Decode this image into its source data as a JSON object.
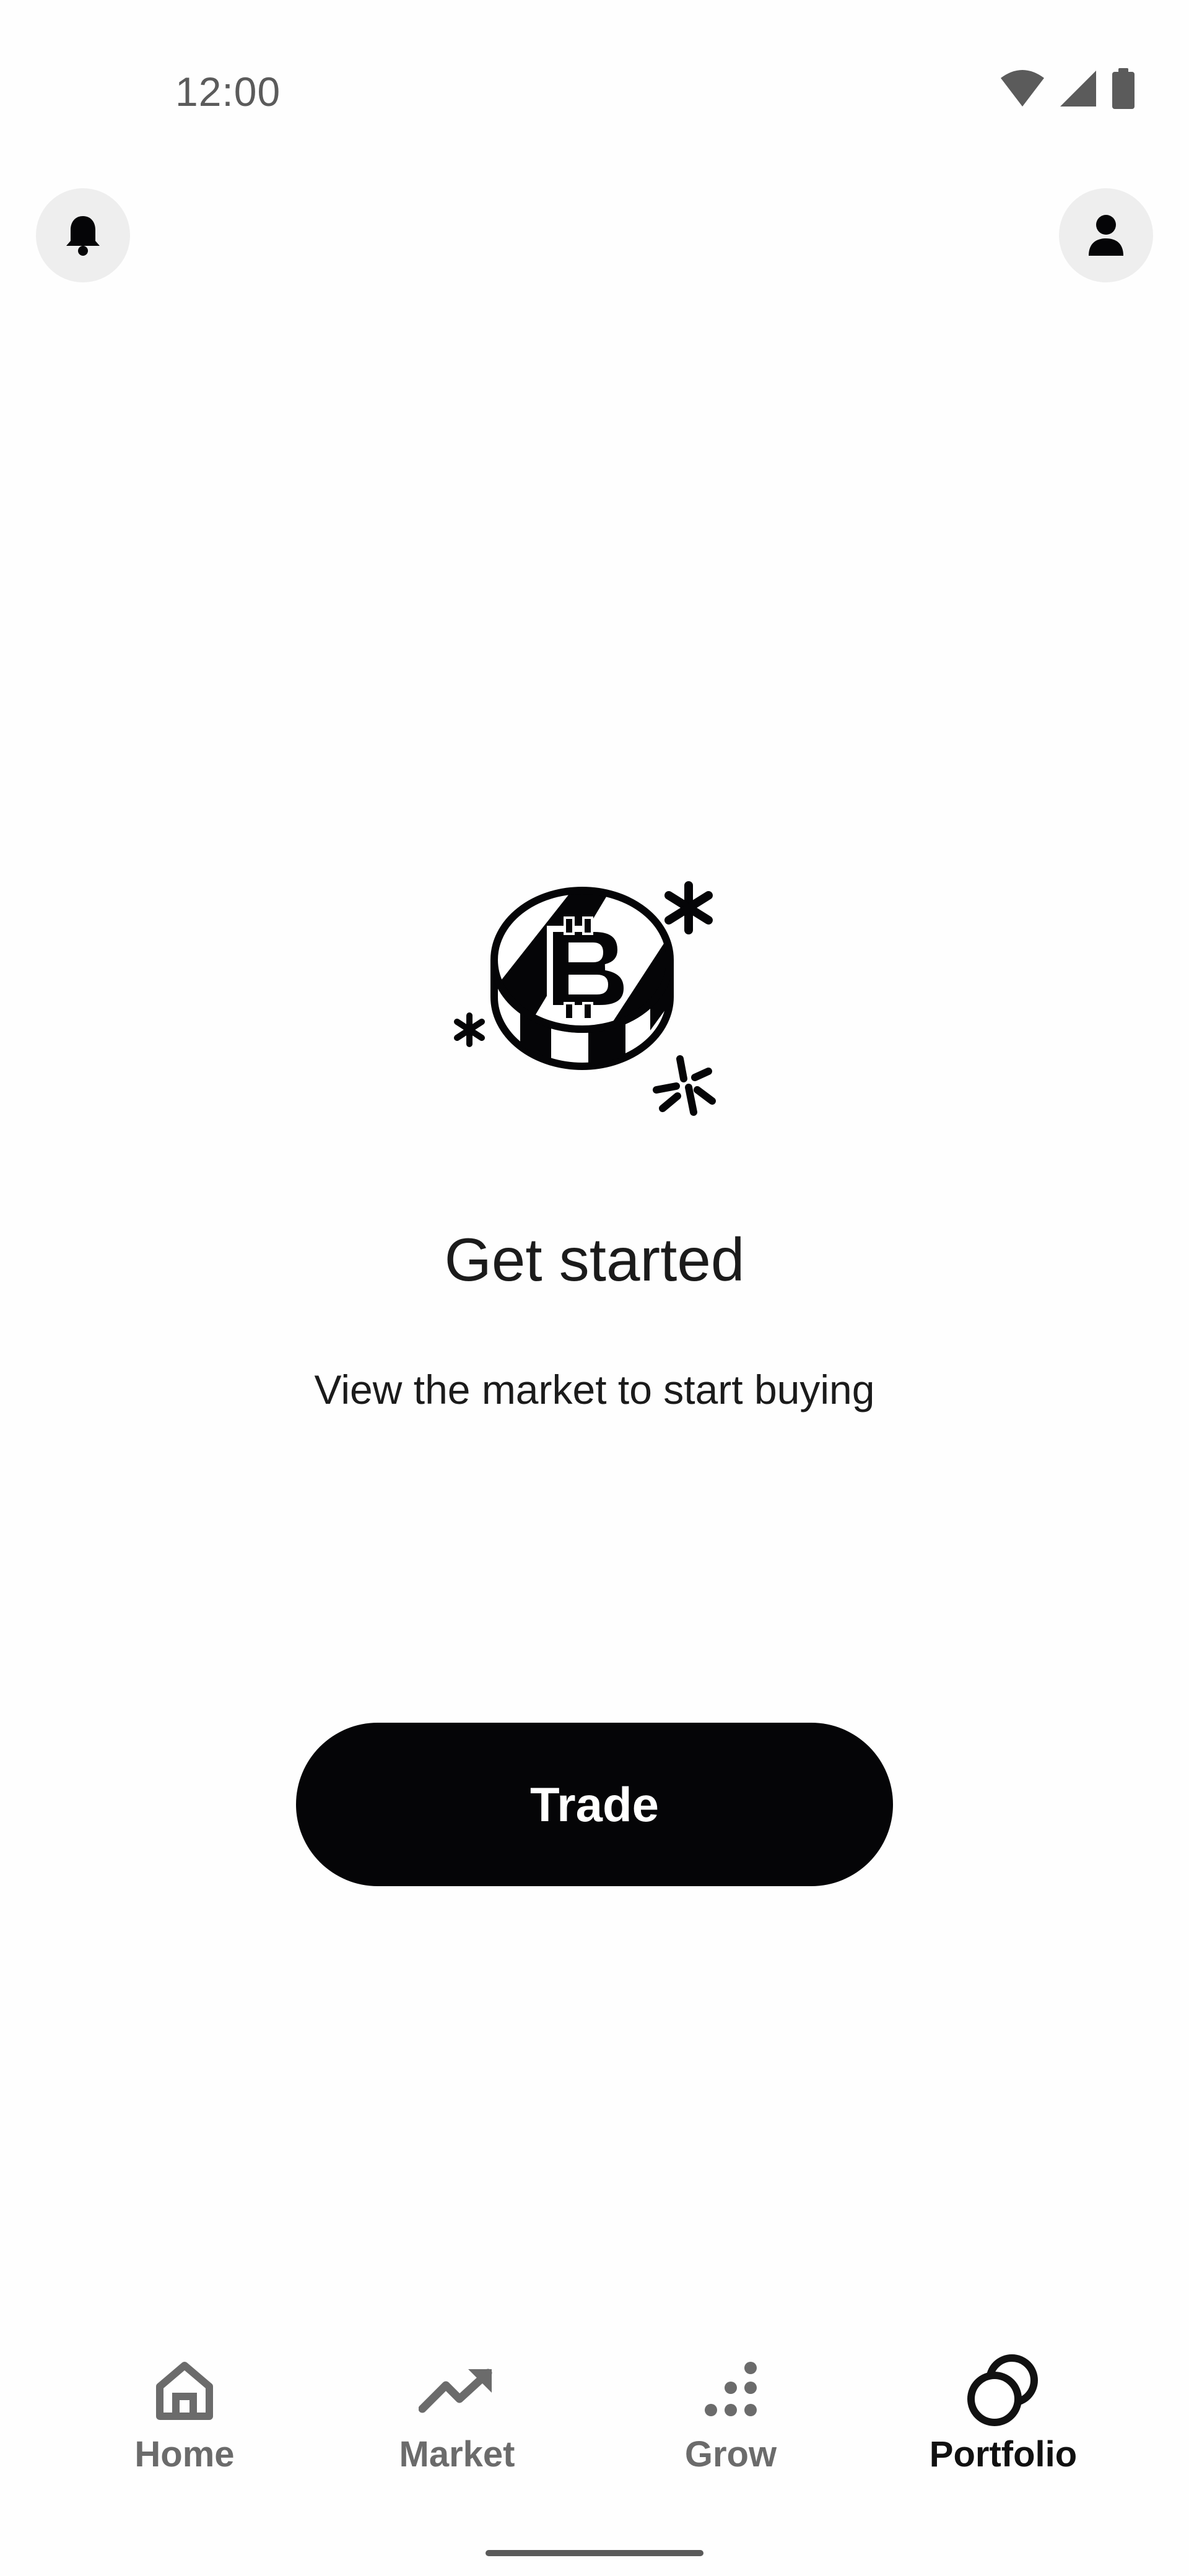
{
  "status_bar": {
    "time": "12:00",
    "icons": [
      "wifi-icon",
      "cellular-signal-icon",
      "battery-icon"
    ]
  },
  "header": {
    "left_button_icon": "bell-icon",
    "right_button_icon": "person-icon"
  },
  "empty_state": {
    "illustration_icon": "bitcoin-coin-illustration",
    "title": "Get started",
    "subtitle": "View the market to start buying",
    "button_label": "Trade"
  },
  "bottom_nav": {
    "items": [
      {
        "label": "Home",
        "icon": "home-icon",
        "active": false
      },
      {
        "label": "Market",
        "icon": "trending-up-icon",
        "active": false
      },
      {
        "label": "Grow",
        "icon": "dots-grow-icon",
        "active": false
      },
      {
        "label": "Portfolio",
        "icon": "portfolio-circles-icon",
        "active": true
      }
    ]
  },
  "colors": {
    "background": "#fefefe",
    "primary_button": "#050507",
    "primary_button_text": "#ffffff",
    "circle_button": "#eeeeee",
    "nav_inactive": "#6b6b6b",
    "nav_active": "#111111"
  }
}
